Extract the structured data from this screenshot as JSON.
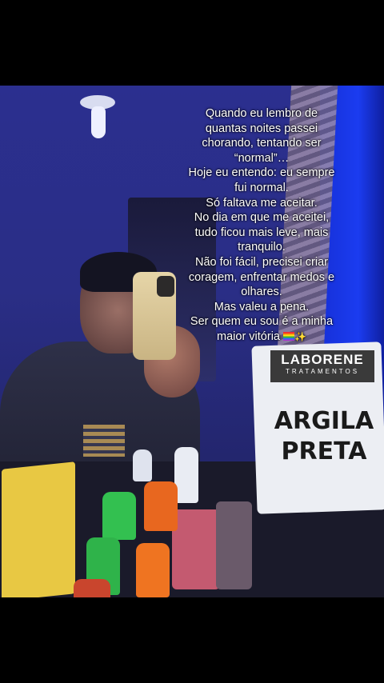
{
  "caption_lines": [
    "Quando eu lembro de",
    "quantas noites passei",
    "chorando, tentando ser",
    "“normal”…",
    "Hoje eu entendo: eu sempre",
    "fui normal.",
    "Só faltava me aceitar.",
    "No dia em que me aceitei,",
    "tudo ficou mais leve, mais",
    "tranquilo.",
    "Não foi fácil, precisei criar",
    "coragem, enfrentar medos e",
    "olhares.",
    "Mas valeu a pena.",
    "Ser quem eu sou é a minha",
    "maior vitória"
  ],
  "caption_emojis": [
    "rainbow-flag-icon",
    "sparkles-icon"
  ],
  "product": {
    "brand": "LABORENE",
    "brand_sub": "TRATAMENTOS",
    "title_line1": "ARGILA",
    "title_line2": "PRETA"
  },
  "colors": {
    "wall": "#2b2f8f",
    "accent_wall": "#1b3cf0",
    "text": "#ffffff"
  }
}
